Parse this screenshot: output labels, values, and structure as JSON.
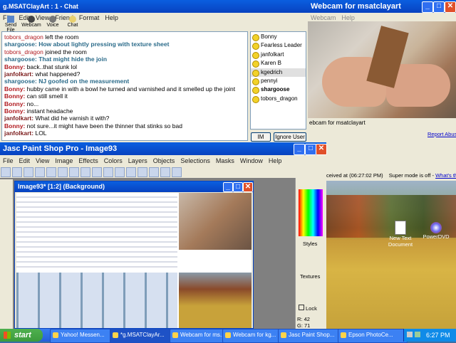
{
  "chat": {
    "title": "g.MSATClayArt : 1 - Chat",
    "menu": [
      "File",
      "Edit",
      "View",
      "Friend",
      "Format",
      "Help"
    ],
    "toolbar": [
      "Send File",
      "Webcam",
      "Voice",
      "Chat"
    ],
    "messages": [
      {
        "name": "tobors_dragon",
        "text": "left the room",
        "style": "system"
      },
      {
        "name": "shargoose:",
        "text": "How about lightly pressing with texture sheet",
        "style": "teal"
      },
      {
        "name": "tobors_dragon",
        "text": "joined the room",
        "style": "system"
      },
      {
        "name": "shargoose:",
        "text": "That might hide the join",
        "style": "teal"
      },
      {
        "name": "Bonny:",
        "text": "back..that stunk lol",
        "style": "plain"
      },
      {
        "name": "janfolkart:",
        "text": "what happened?",
        "style": "plain"
      },
      {
        "name": "shargoose:",
        "text": "NJ goofed on the measurement",
        "style": "teal"
      },
      {
        "name": "Bonny:",
        "text": "hubby came in with a bowl he turned and varnished and it smelled up the joint",
        "style": "plain"
      },
      {
        "name": "Bonny:",
        "text": "can still smell it",
        "style": "plain"
      },
      {
        "name": "Bonny:",
        "text": "no...",
        "style": "plain"
      },
      {
        "name": "Bonny:",
        "text": "instant headache",
        "style": "plain"
      },
      {
        "name": "janfolkart:",
        "text": "What did he varnish it with?",
        "style": "plain"
      },
      {
        "name": "Bonny:",
        "text": "not sure...it might have been the thinner that stinks so bad",
        "style": "plain"
      },
      {
        "name": "janfolkart:",
        "text": "LOL",
        "style": "plain"
      }
    ],
    "buddies": [
      "Bonny",
      "Fearless Leader",
      "janfolkart",
      "Karen B",
      "kgedrich",
      "pennyi",
      "shargoose",
      "tobors_dragon"
    ],
    "im_label": "IM",
    "ignore_label": "Ignore User"
  },
  "webcam": {
    "title": "Webcam for msatclayart",
    "menu": [
      "Webcam",
      "Help"
    ],
    "status": "ebcam for msatclayart",
    "report_link": "Report Abuse",
    "received": "ceived at (06:27:02 PM)",
    "super_mode": "Super mode is off -",
    "whats_this": "What's this?"
  },
  "psp": {
    "title": "Jasc Paint Shop Pro - Image93",
    "menu": [
      "File",
      "Edit",
      "View",
      "Image",
      "Effects",
      "Colors",
      "Layers",
      "Objects",
      "Selections",
      "Masks",
      "Window",
      "Help"
    ],
    "image_title": "Image93* [1:2] (Background)",
    "styles_label": "Styles",
    "textures_label": "Textures",
    "lock_label": "Lock",
    "r_label": "R: 42",
    "g_label": "G: 71"
  },
  "desktop": {
    "icons": [
      "New Text Document",
      "PowerDVD"
    ]
  },
  "taskbar": {
    "start": "start",
    "tasks": [
      "Yahoo! Messen...",
      "*g.MSATClayAr...",
      "Webcam for ms...",
      "Webcam for kg...",
      "Jasc Paint Shop...",
      "Epson PhotoCe..."
    ],
    "clock": "6:27 PM"
  },
  "colors": {
    "xp_blue": "#0a5fe0",
    "taskbar": "#245edb",
    "start_green": "#3c9b3c"
  }
}
